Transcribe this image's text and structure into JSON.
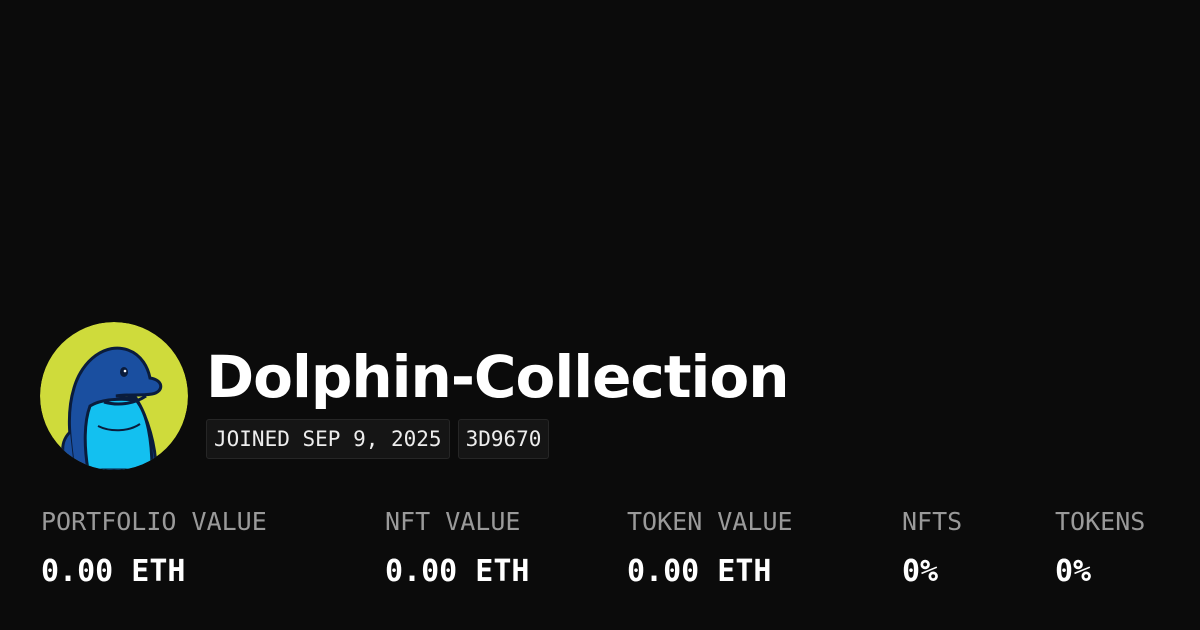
{
  "profile": {
    "name": "Dolphin-Collection",
    "avatar_icon": "dolphin-avatar-icon",
    "avatar_bg_color": "#cfdb3b",
    "joined": "JOINED SEP 9, 2025",
    "id_tag": "3D9670"
  },
  "stats": [
    {
      "label": "PORTFOLIO VALUE",
      "value": "0.00 ETH"
    },
    {
      "label": "NFT VALUE",
      "value": "0.00 ETH"
    },
    {
      "label": "TOKEN VALUE",
      "value": "0.00 ETH"
    },
    {
      "label": "NFTS",
      "value": "0%"
    },
    {
      "label": "TOKENS",
      "value": "0%"
    }
  ]
}
